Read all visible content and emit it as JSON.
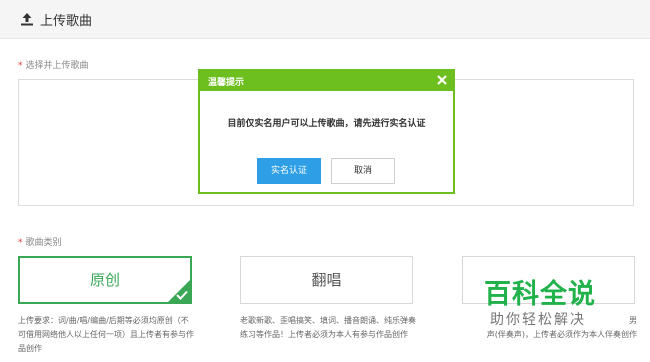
{
  "header": {
    "title": "上传歌曲",
    "icon": "upload-icon"
  },
  "upload_section": {
    "required_mark": "*",
    "label": "选择并上传歌曲"
  },
  "category_section": {
    "required_mark": "*",
    "label": "歌曲类别",
    "cards": [
      {
        "label": "原创",
        "selected": true
      },
      {
        "label": "翻唱",
        "selected": false
      },
      {
        "label": "",
        "selected": false
      }
    ],
    "descriptions": [
      {
        "lines": [
          "上传要求：词/曲/唱/编曲/后期等必须均原创（不",
          "可借用网络他人以上任何一项）且上传者有参与作",
          "品创作"
        ]
      },
      {
        "lines": [
          "老歌新歌、歪唱搞笑、填词、播音朗诵、纯乐弹奏",
          "练习等作品！上传者必须为本人有参与作品创作"
        ]
      },
      {
        "lines": [
          "男",
          "声(伴奏声)，上传者必须作为本人伴奏创作"
        ]
      }
    ]
  },
  "modal": {
    "title": "温馨提示",
    "message": "目前仅实名用户可以上传歌曲，请先进行实名认证",
    "confirm_label": "实名认证",
    "cancel_label": "取消",
    "accent_color": "#6cbf1e",
    "button_color": "#2e9fe6"
  },
  "watermark": {
    "title": "百科全说",
    "subtitle": "助你轻松解决"
  }
}
